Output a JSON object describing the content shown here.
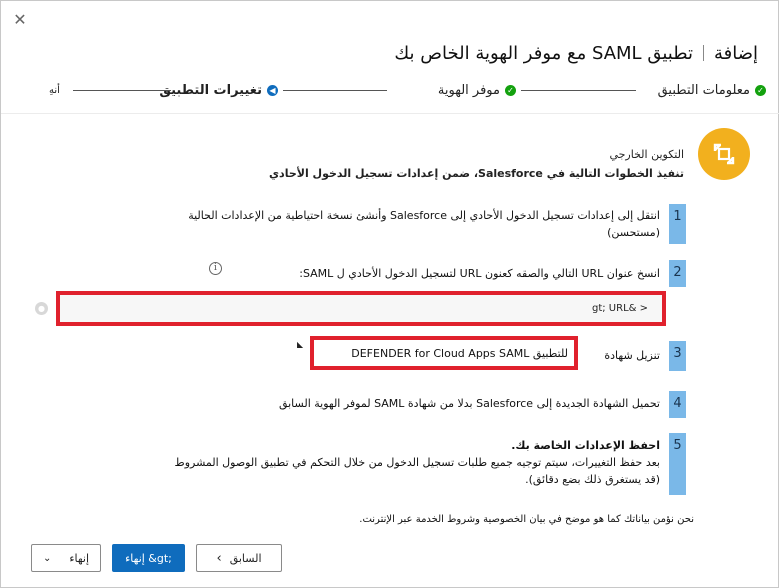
{
  "window": {
    "close_glyph": "✕"
  },
  "header": {
    "add_label": "إضافة",
    "title": "تطبيق SAML مع موفر الهوية الخاص بك"
  },
  "stepper": {
    "steps": [
      {
        "label": "معلومات التطبيق",
        "state": "done"
      },
      {
        "label": "موفر الهوية",
        "state": "done"
      },
      {
        "label": "تغييرات التطبيق",
        "state": "current"
      },
      {
        "label": "أنهِ",
        "state": "pending"
      }
    ]
  },
  "intro": {
    "icon": "external-config-icon",
    "title": "التكوين الخارجي",
    "subtitle": "تنفيذ الخطوات التالية في Salesforce، ضمن إعدادات تسجيل الدخول الأحادي"
  },
  "steps": [
    {
      "num": "1",
      "lines": [
        "انتقل إلى إعدادات تسجيل الدخول الأحادي إلى Salesforce وأنشئ نسخة احتياطية من الإعدادات الحالية",
        "(مستحسن)"
      ]
    },
    {
      "num": "2",
      "lines": [
        "انسخ عنوان URL التالي والصقه كعنون URL لتسجيل الدخول الأحادي ل SAML:"
      ]
    },
    {
      "num": "3",
      "lines": [
        "تنزيل شهادة"
      ]
    },
    {
      "num": "4",
      "lines": [
        "تحميل الشهادة الجديدة إلى Salesforce بدلا من شهادة SAML لموفر الهوية السابق"
      ]
    },
    {
      "num": "5",
      "lines": [
        "احفظ الإعدادات الخاصة بك.",
        "بعد حفظ التغييرات، سيتم توجيه جميع طلبات تسجيل الدخول من خلال التحكم في تطبيق الوصول المشروط",
        "(قد يستغرق ذلك بضع دقائق)."
      ]
    }
  ],
  "url_box": {
    "value": "gt; URL& >"
  },
  "cert_box": {
    "text": "DEFENDER for Cloud Apps SAML للتطبيق"
  },
  "footer_note": "نحن نؤمن بياناتك كما هو موضح في بيان الخصوصية وشروط الخدمة عبر الإنترنت.",
  "buttons": {
    "finish_dropdown": "إنهاء",
    "finish_primary": "إنهاء &gt;",
    "back": "السابق"
  },
  "colors": {
    "accent": "#0f6cbd",
    "done": "#13a10e",
    "highlight": "#e0212d",
    "intro_icon_bg": "#f2b01e",
    "step_badge": "#7ab8e8"
  }
}
